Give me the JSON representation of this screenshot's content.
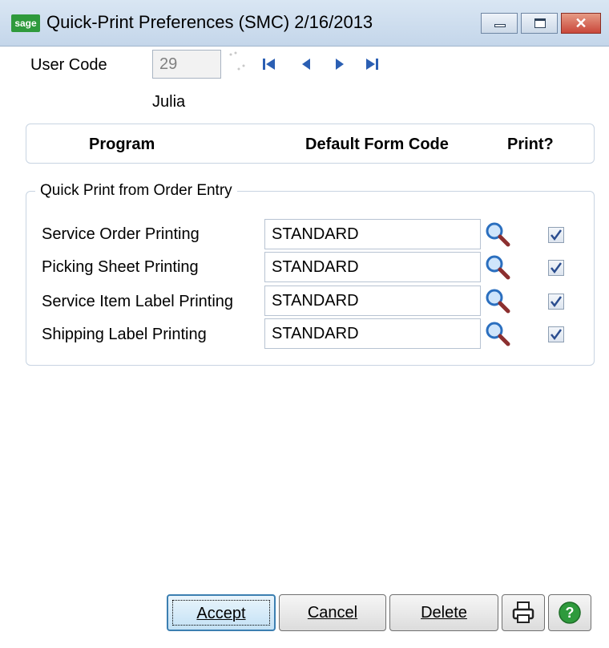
{
  "window": {
    "logo_text": "sage",
    "title": "Quick-Print Preferences (SMC) 2/16/2013",
    "close_glyph": "✕"
  },
  "user": {
    "code_label": "User Code",
    "code_value": "29",
    "name": "Julia"
  },
  "columns": {
    "program": "Program",
    "default_form_code": "Default Form Code",
    "print": "Print?"
  },
  "group": {
    "title": "Quick Print from Order Entry",
    "rows": [
      {
        "label": "Service Order Printing",
        "form_code": "STANDARD",
        "print": true
      },
      {
        "label": "Picking Sheet Printing",
        "form_code": "STANDARD",
        "print": true
      },
      {
        "label": "Service Item Label Printing",
        "form_code": "STANDARD",
        "print": true
      },
      {
        "label": "Shipping Label Printing",
        "form_code": "STANDARD",
        "print": true
      }
    ]
  },
  "buttons": {
    "accept": "Accept",
    "cancel": "Cancel",
    "delete": "Delete"
  },
  "icons": {
    "nav_first": "first-record-icon",
    "nav_prev": "previous-record-icon",
    "nav_next": "next-record-icon",
    "nav_last": "last-record-icon",
    "lookup": "magnifier-icon",
    "print": "printer-icon",
    "help": "help-icon"
  },
  "colors": {
    "nav_blue": "#2b5fb3",
    "help_green": "#2e9a3c",
    "logo_green": "#2f9a3c"
  }
}
